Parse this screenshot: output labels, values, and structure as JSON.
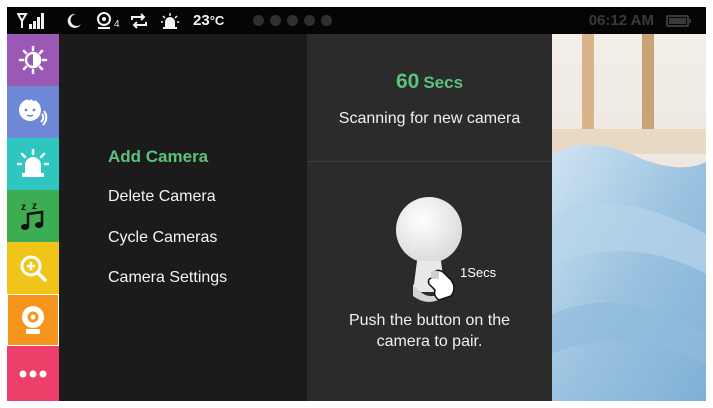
{
  "status_bar": {
    "temperature": "23",
    "temperature_unit": "°C",
    "time": "06:12 AM",
    "camera_count": "4",
    "icons": [
      "signal-icon",
      "moon-icon",
      "camera-count-icon",
      "repeat-icon",
      "alarm-icon",
      "page-dots",
      "battery-icon"
    ]
  },
  "rail": {
    "items": [
      {
        "name": "brightness",
        "icon": "brightness-icon",
        "color": "#9b59b6"
      },
      {
        "name": "baby-sound",
        "icon": "baby-face-icon",
        "color": "#6e87d6"
      },
      {
        "name": "alarm",
        "icon": "alarm-light-icon",
        "color": "#2fc6c0"
      },
      {
        "name": "lullaby",
        "icon": "sleep-music-icon",
        "color": "#3cad52"
      },
      {
        "name": "zoom",
        "icon": "zoom-in-icon",
        "color": "#f0c419"
      },
      {
        "name": "camera",
        "icon": "camera-icon",
        "color": "#f7941d",
        "active": true
      },
      {
        "name": "more",
        "icon": "more-dots-icon",
        "color": "#ee3f6b"
      }
    ]
  },
  "menu": {
    "items": [
      {
        "label": "Add Camera",
        "active": true
      },
      {
        "label": "Delete Camera"
      },
      {
        "label": "Cycle Cameras"
      },
      {
        "label": "Camera Settings"
      }
    ]
  },
  "panel": {
    "timer_value": "60",
    "timer_unit": "Secs",
    "scan_text": "Scanning for new camera",
    "press_duration": "1Secs",
    "instruction": "Push the button on the camera to pair."
  },
  "colors": {
    "accent_green": "#5cc17d",
    "menu_bg": "#1b1b1b",
    "panel_bg": "#2b2b2b",
    "status_bar_bg": "#050505"
  }
}
